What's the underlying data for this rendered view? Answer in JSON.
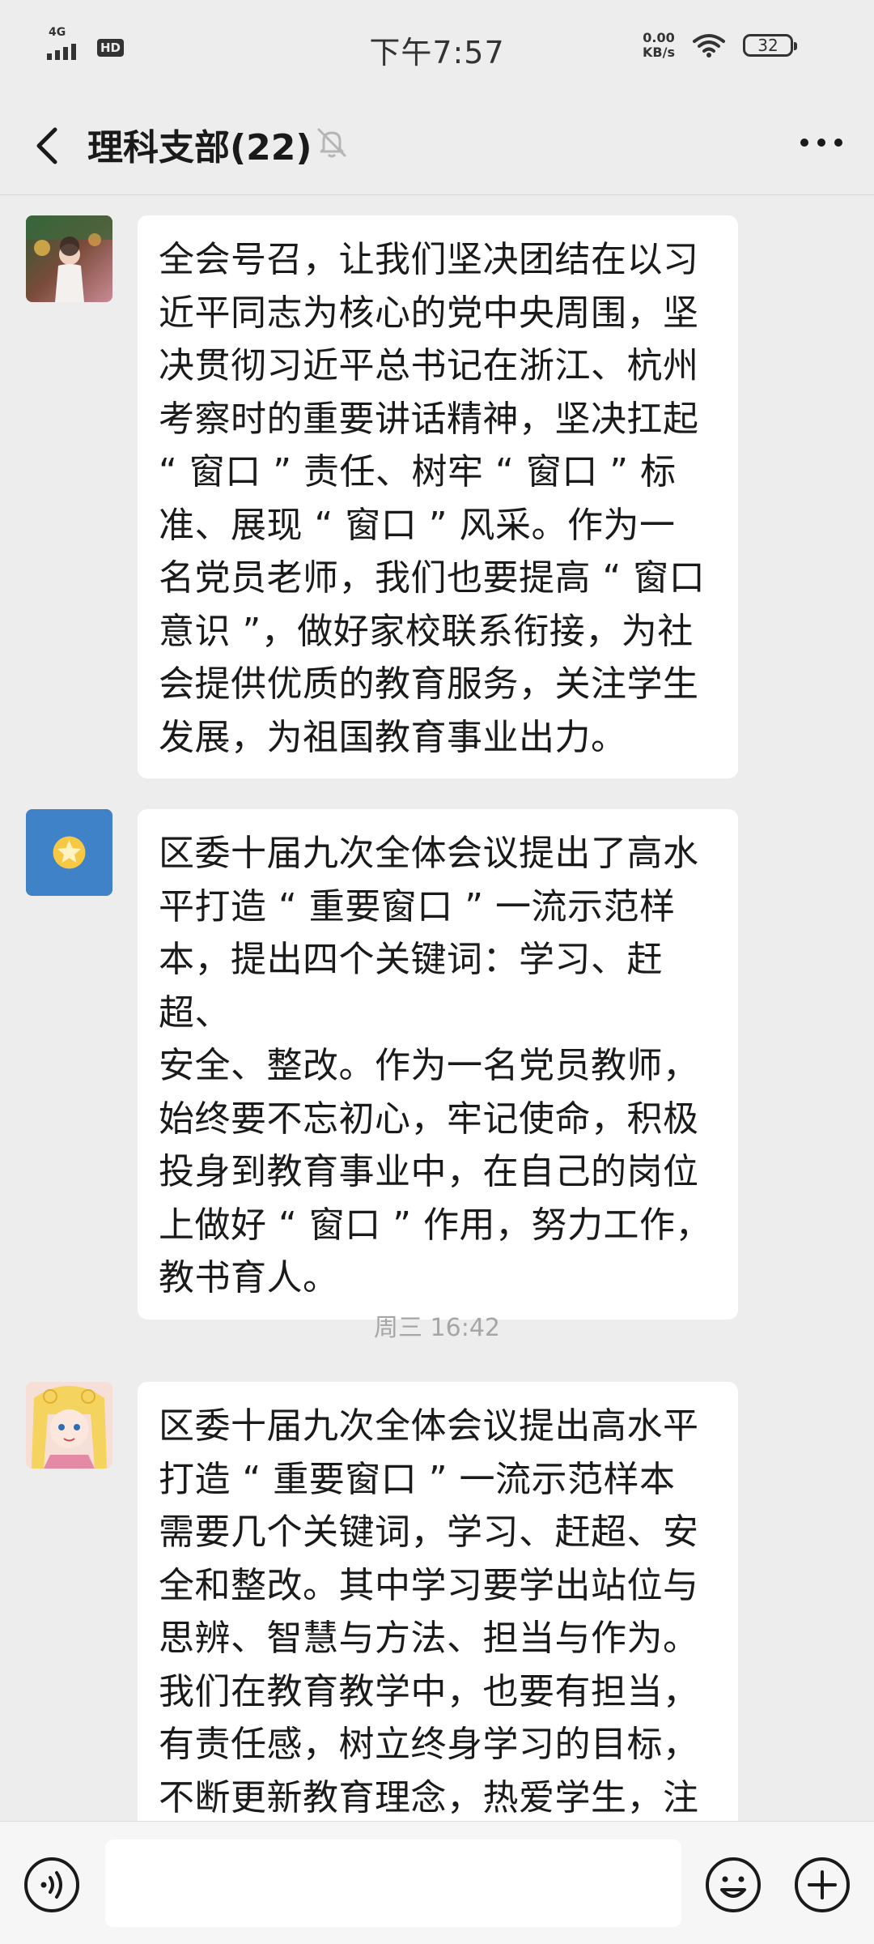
{
  "status_bar": {
    "network": "4G",
    "hd": "HD",
    "time": "下午7:57",
    "net_speed_value": "0.00",
    "net_speed_unit": "KB/s",
    "battery": "32"
  },
  "header": {
    "title": "理科支部(22)",
    "back_icon": "chevron-left-icon",
    "mute_icon": "bell-muted-icon",
    "more_icon": "more-dots-icon"
  },
  "messages": [
    {
      "avatar": "photo-avatar-child",
      "text": "全会号召，让我们坚决团结在以习\n近平同志为核心的党中央周围，坚\n决贯彻习近平总书记在浙江、杭州\n考察时的重要讲话精神，坚决扛起\n“ 窗口 ” 责任、树牢 “ 窗口 ” 标\n准、展现 “ 窗口 ” 风采。作为一\n名党员老师，我们也要提高 “ 窗口\n意识 ”，做好家校联系衔接，为社\n会提供优质的教育服务，关注学生\n发展，为祖国教育事业出力。"
    },
    {
      "avatar": "star-avatar",
      "text": "区委十届九次全体会议提出了高水\n平打造 “ 重要窗口 ” 一流示范样\n本，提出四个关键词：学习、赶超、\n安全、整改。作为一名党员教师，\n始终要不忘初心，牢记使命，积极\n投身到教育事业中，在自己的岗位\n上做好 “ 窗口 ” 作用，努力工作，\n教书育人。"
    },
    {
      "avatar": "cartoon-avatar",
      "text": "区委十届九次全体会议提出高水平\n打造 “ 重要窗口 ” 一流示范样本\n需要几个关键词，学习、赶超、安\n全和整改。其中学习要学出站位与\n思辨、智慧与方法、担当与作为。\n我们在教育教学中，也要有担当，\n有责任感，树立终身学习的目标，\n不断更新教育理念，热爱学生，注"
    }
  ],
  "timestamp": "周三 16:42",
  "input_bar": {
    "voice_icon": "voice-icon",
    "input_value": "",
    "emoji_icon": "emoji-icon",
    "plus_icon": "plus-icon"
  },
  "colors": {
    "background": "#ededed",
    "bubble": "#ffffff",
    "timestamp": "#a6a6a6",
    "star_avatar_bg": "#3f82c8",
    "star_color": "#f7c843"
  }
}
